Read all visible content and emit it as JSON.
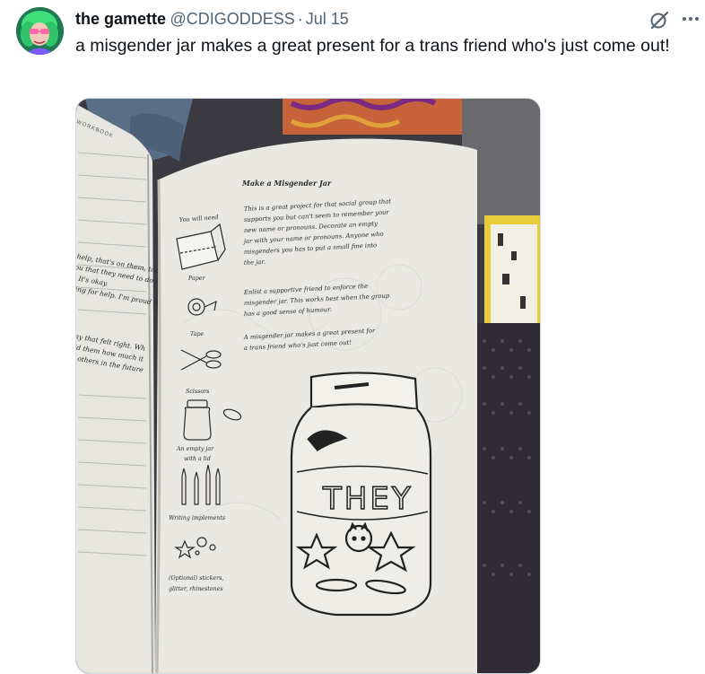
{
  "tweet": {
    "display_name": "the gamette",
    "handle": "@CDIGODDESS",
    "separator": "·",
    "date": "Jul 15",
    "text": "a misgender jar makes a great present for a trans friend who's just come out!"
  },
  "photo": {
    "left_page": {
      "corner_label": "WORKBOOK",
      "lines": [
        "help, that's on them, too so",
        "ou that they need to do it",
        "It's okay.",
        "king for help. I'm proud of",
        "a way that felt right. Wh",
        "u told them how much it",
        "from others in the future"
      ]
    },
    "right_page": {
      "title": "Make a Misgender Jar",
      "you_will_need": "You will need",
      "materials": [
        "Paper",
        "Tape",
        "Scissors",
        "An empty jar",
        "with a lid",
        "Writing implements",
        "(Optional) stickers,",
        "glitter, rhinestones"
      ],
      "paragraph1": [
        "This is a great project for that social group that",
        "supports you but can't seem to remember your",
        "new name or pronouns. Decorate an empty",
        "jar with your name or pronouns. Anyone who",
        "misgenders you has to put a small fine into",
        "the jar."
      ],
      "paragraph2": [
        "Enlist a supportive friend to enforce the",
        "misgender jar. This works best when the group",
        "has a good sense of humour."
      ],
      "paragraph3": [
        "A misgender jar makes a great present for",
        "a trans friend who's just come out!"
      ],
      "jar_label": "THEY"
    }
  },
  "icons": {
    "grok": "grok-icon",
    "more": "more-icon"
  }
}
